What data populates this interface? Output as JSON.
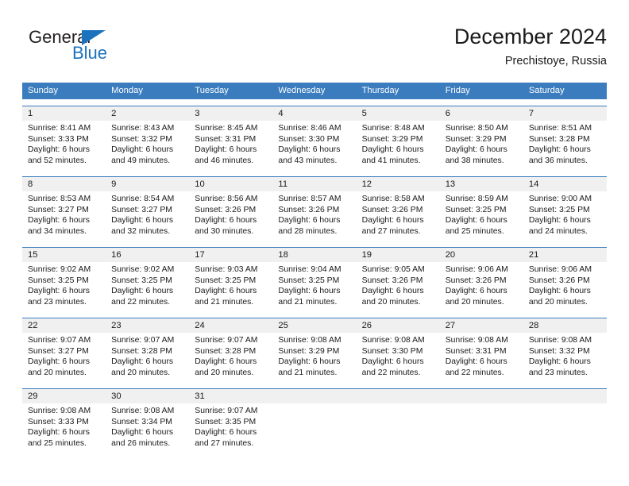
{
  "brand": {
    "name_part1": "General",
    "name_part2": "Blue",
    "triangle_color": "#1b72bd"
  },
  "header": {
    "title": "December 2024",
    "subtitle": "Prechistoye, Russia"
  },
  "theme": {
    "header_blue": "#3a7cbe",
    "daynum_band": "#f0f0f0",
    "text": "#1a1a1a"
  },
  "weekdays": [
    "Sunday",
    "Monday",
    "Tuesday",
    "Wednesday",
    "Thursday",
    "Friday",
    "Saturday"
  ],
  "weeks": [
    [
      {
        "day": "1",
        "sunrise": "Sunrise: 8:41 AM",
        "sunset": "Sunset: 3:33 PM",
        "daylight1": "Daylight: 6 hours",
        "daylight2": "and 52 minutes."
      },
      {
        "day": "2",
        "sunrise": "Sunrise: 8:43 AM",
        "sunset": "Sunset: 3:32 PM",
        "daylight1": "Daylight: 6 hours",
        "daylight2": "and 49 minutes."
      },
      {
        "day": "3",
        "sunrise": "Sunrise: 8:45 AM",
        "sunset": "Sunset: 3:31 PM",
        "daylight1": "Daylight: 6 hours",
        "daylight2": "and 46 minutes."
      },
      {
        "day": "4",
        "sunrise": "Sunrise: 8:46 AM",
        "sunset": "Sunset: 3:30 PM",
        "daylight1": "Daylight: 6 hours",
        "daylight2": "and 43 minutes."
      },
      {
        "day": "5",
        "sunrise": "Sunrise: 8:48 AM",
        "sunset": "Sunset: 3:29 PM",
        "daylight1": "Daylight: 6 hours",
        "daylight2": "and 41 minutes."
      },
      {
        "day": "6",
        "sunrise": "Sunrise: 8:50 AM",
        "sunset": "Sunset: 3:29 PM",
        "daylight1": "Daylight: 6 hours",
        "daylight2": "and 38 minutes."
      },
      {
        "day": "7",
        "sunrise": "Sunrise: 8:51 AM",
        "sunset": "Sunset: 3:28 PM",
        "daylight1": "Daylight: 6 hours",
        "daylight2": "and 36 minutes."
      }
    ],
    [
      {
        "day": "8",
        "sunrise": "Sunrise: 8:53 AM",
        "sunset": "Sunset: 3:27 PM",
        "daylight1": "Daylight: 6 hours",
        "daylight2": "and 34 minutes."
      },
      {
        "day": "9",
        "sunrise": "Sunrise: 8:54 AM",
        "sunset": "Sunset: 3:27 PM",
        "daylight1": "Daylight: 6 hours",
        "daylight2": "and 32 minutes."
      },
      {
        "day": "10",
        "sunrise": "Sunrise: 8:56 AM",
        "sunset": "Sunset: 3:26 PM",
        "daylight1": "Daylight: 6 hours",
        "daylight2": "and 30 minutes."
      },
      {
        "day": "11",
        "sunrise": "Sunrise: 8:57 AM",
        "sunset": "Sunset: 3:26 PM",
        "daylight1": "Daylight: 6 hours",
        "daylight2": "and 28 minutes."
      },
      {
        "day": "12",
        "sunrise": "Sunrise: 8:58 AM",
        "sunset": "Sunset: 3:26 PM",
        "daylight1": "Daylight: 6 hours",
        "daylight2": "and 27 minutes."
      },
      {
        "day": "13",
        "sunrise": "Sunrise: 8:59 AM",
        "sunset": "Sunset: 3:25 PM",
        "daylight1": "Daylight: 6 hours",
        "daylight2": "and 25 minutes."
      },
      {
        "day": "14",
        "sunrise": "Sunrise: 9:00 AM",
        "sunset": "Sunset: 3:25 PM",
        "daylight1": "Daylight: 6 hours",
        "daylight2": "and 24 minutes."
      }
    ],
    [
      {
        "day": "15",
        "sunrise": "Sunrise: 9:02 AM",
        "sunset": "Sunset: 3:25 PM",
        "daylight1": "Daylight: 6 hours",
        "daylight2": "and 23 minutes."
      },
      {
        "day": "16",
        "sunrise": "Sunrise: 9:02 AM",
        "sunset": "Sunset: 3:25 PM",
        "daylight1": "Daylight: 6 hours",
        "daylight2": "and 22 minutes."
      },
      {
        "day": "17",
        "sunrise": "Sunrise: 9:03 AM",
        "sunset": "Sunset: 3:25 PM",
        "daylight1": "Daylight: 6 hours",
        "daylight2": "and 21 minutes."
      },
      {
        "day": "18",
        "sunrise": "Sunrise: 9:04 AM",
        "sunset": "Sunset: 3:25 PM",
        "daylight1": "Daylight: 6 hours",
        "daylight2": "and 21 minutes."
      },
      {
        "day": "19",
        "sunrise": "Sunrise: 9:05 AM",
        "sunset": "Sunset: 3:26 PM",
        "daylight1": "Daylight: 6 hours",
        "daylight2": "and 20 minutes."
      },
      {
        "day": "20",
        "sunrise": "Sunrise: 9:06 AM",
        "sunset": "Sunset: 3:26 PM",
        "daylight1": "Daylight: 6 hours",
        "daylight2": "and 20 minutes."
      },
      {
        "day": "21",
        "sunrise": "Sunrise: 9:06 AM",
        "sunset": "Sunset: 3:26 PM",
        "daylight1": "Daylight: 6 hours",
        "daylight2": "and 20 minutes."
      }
    ],
    [
      {
        "day": "22",
        "sunrise": "Sunrise: 9:07 AM",
        "sunset": "Sunset: 3:27 PM",
        "daylight1": "Daylight: 6 hours",
        "daylight2": "and 20 minutes."
      },
      {
        "day": "23",
        "sunrise": "Sunrise: 9:07 AM",
        "sunset": "Sunset: 3:28 PM",
        "daylight1": "Daylight: 6 hours",
        "daylight2": "and 20 minutes."
      },
      {
        "day": "24",
        "sunrise": "Sunrise: 9:07 AM",
        "sunset": "Sunset: 3:28 PM",
        "daylight1": "Daylight: 6 hours",
        "daylight2": "and 20 minutes."
      },
      {
        "day": "25",
        "sunrise": "Sunrise: 9:08 AM",
        "sunset": "Sunset: 3:29 PM",
        "daylight1": "Daylight: 6 hours",
        "daylight2": "and 21 minutes."
      },
      {
        "day": "26",
        "sunrise": "Sunrise: 9:08 AM",
        "sunset": "Sunset: 3:30 PM",
        "daylight1": "Daylight: 6 hours",
        "daylight2": "and 22 minutes."
      },
      {
        "day": "27",
        "sunrise": "Sunrise: 9:08 AM",
        "sunset": "Sunset: 3:31 PM",
        "daylight1": "Daylight: 6 hours",
        "daylight2": "and 22 minutes."
      },
      {
        "day": "28",
        "sunrise": "Sunrise: 9:08 AM",
        "sunset": "Sunset: 3:32 PM",
        "daylight1": "Daylight: 6 hours",
        "daylight2": "and 23 minutes."
      }
    ],
    [
      {
        "day": "29",
        "sunrise": "Sunrise: 9:08 AM",
        "sunset": "Sunset: 3:33 PM",
        "daylight1": "Daylight: 6 hours",
        "daylight2": "and 25 minutes."
      },
      {
        "day": "30",
        "sunrise": "Sunrise: 9:08 AM",
        "sunset": "Sunset: 3:34 PM",
        "daylight1": "Daylight: 6 hours",
        "daylight2": "and 26 minutes."
      },
      {
        "day": "31",
        "sunrise": "Sunrise: 9:07 AM",
        "sunset": "Sunset: 3:35 PM",
        "daylight1": "Daylight: 6 hours",
        "daylight2": "and 27 minutes."
      },
      {
        "day": "",
        "sunrise": "",
        "sunset": "",
        "daylight1": "",
        "daylight2": ""
      },
      {
        "day": "",
        "sunrise": "",
        "sunset": "",
        "daylight1": "",
        "daylight2": ""
      },
      {
        "day": "",
        "sunrise": "",
        "sunset": "",
        "daylight1": "",
        "daylight2": ""
      },
      {
        "day": "",
        "sunrise": "",
        "sunset": "",
        "daylight1": "",
        "daylight2": ""
      }
    ]
  ]
}
